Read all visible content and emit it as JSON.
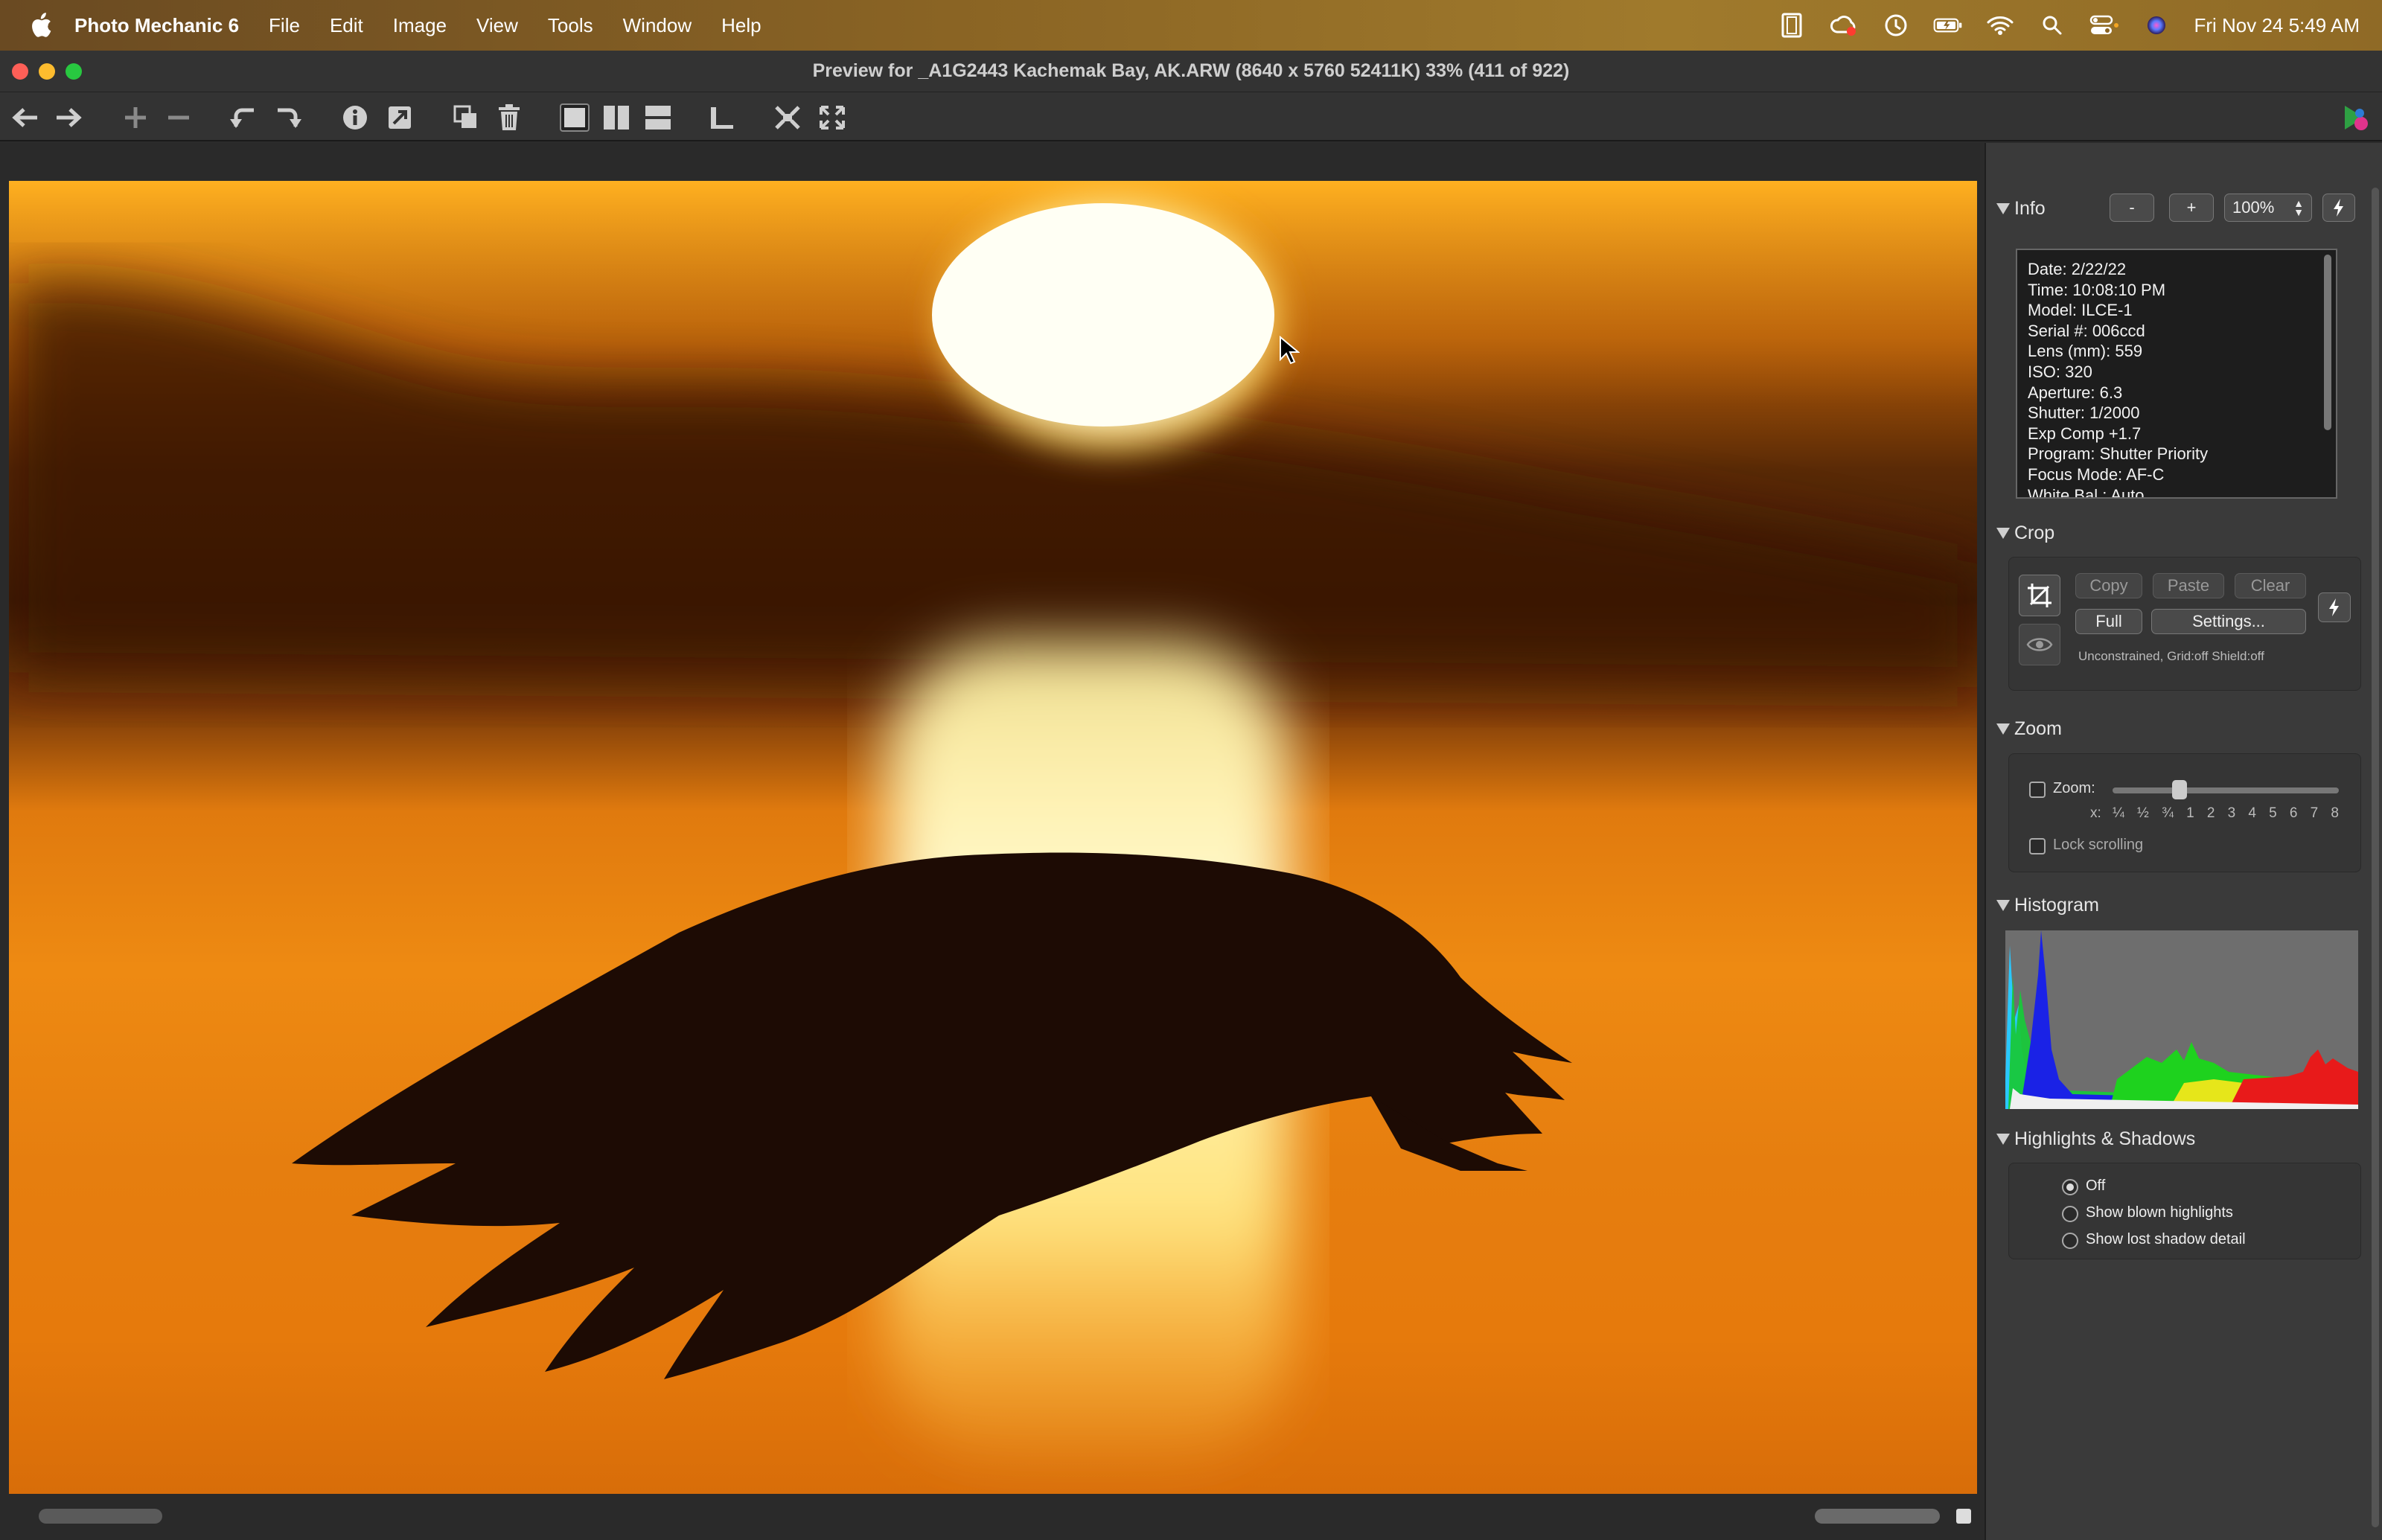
{
  "menubar": {
    "app_name": "Photo Mechanic 6",
    "menus": [
      "File",
      "Edit",
      "Image",
      "View",
      "Tools",
      "Window",
      "Help"
    ],
    "datetime": "Fri Nov 24  5:49 AM"
  },
  "window": {
    "title": "Preview for _A1G2443 Kachemak Bay, AK.ARW (8640 x 5760 52411K) 33% (411 of 922)"
  },
  "info": {
    "title": "Info",
    "minus_label": "-",
    "plus_label": "+",
    "zoom_value": "100%",
    "lines": [
      "Date: 2/22/22",
      "Time: 10:08:10 PM",
      "Model: ILCE-1",
      "Serial #: 006ccd",
      "Lens (mm): 559",
      "ISO: 320",
      "Aperture: 6.3",
      "Shutter: 1/2000",
      "Exp Comp +1.7",
      "Program: Shutter Priority",
      "Focus Mode: AF-C",
      "White Bal.: Auto"
    ]
  },
  "crop": {
    "title": "Crop",
    "copy": "Copy",
    "paste": "Paste",
    "clear": "Clear",
    "full": "Full",
    "settings": "Settings...",
    "status": "Unconstrained, Grid:off Shield:off"
  },
  "zoom": {
    "title": "Zoom",
    "label": "Zoom:",
    "scale_prefix": "x:",
    "scale": [
      "¼",
      "½",
      "¾",
      "1",
      "2",
      "3",
      "4",
      "5",
      "6",
      "7",
      "8"
    ],
    "lock_scrolling": "Lock scrolling",
    "slider_level": 0.28
  },
  "histogram": {
    "title": "Histogram"
  },
  "highlights": {
    "title": "Highlights & Shadows",
    "options": [
      "Off",
      "Show blown highlights",
      "Show lost shadow detail"
    ],
    "selected": 0
  },
  "colors": {
    "close": "#fe5f57",
    "minimize": "#febc2e",
    "zoom": "#28c840"
  }
}
